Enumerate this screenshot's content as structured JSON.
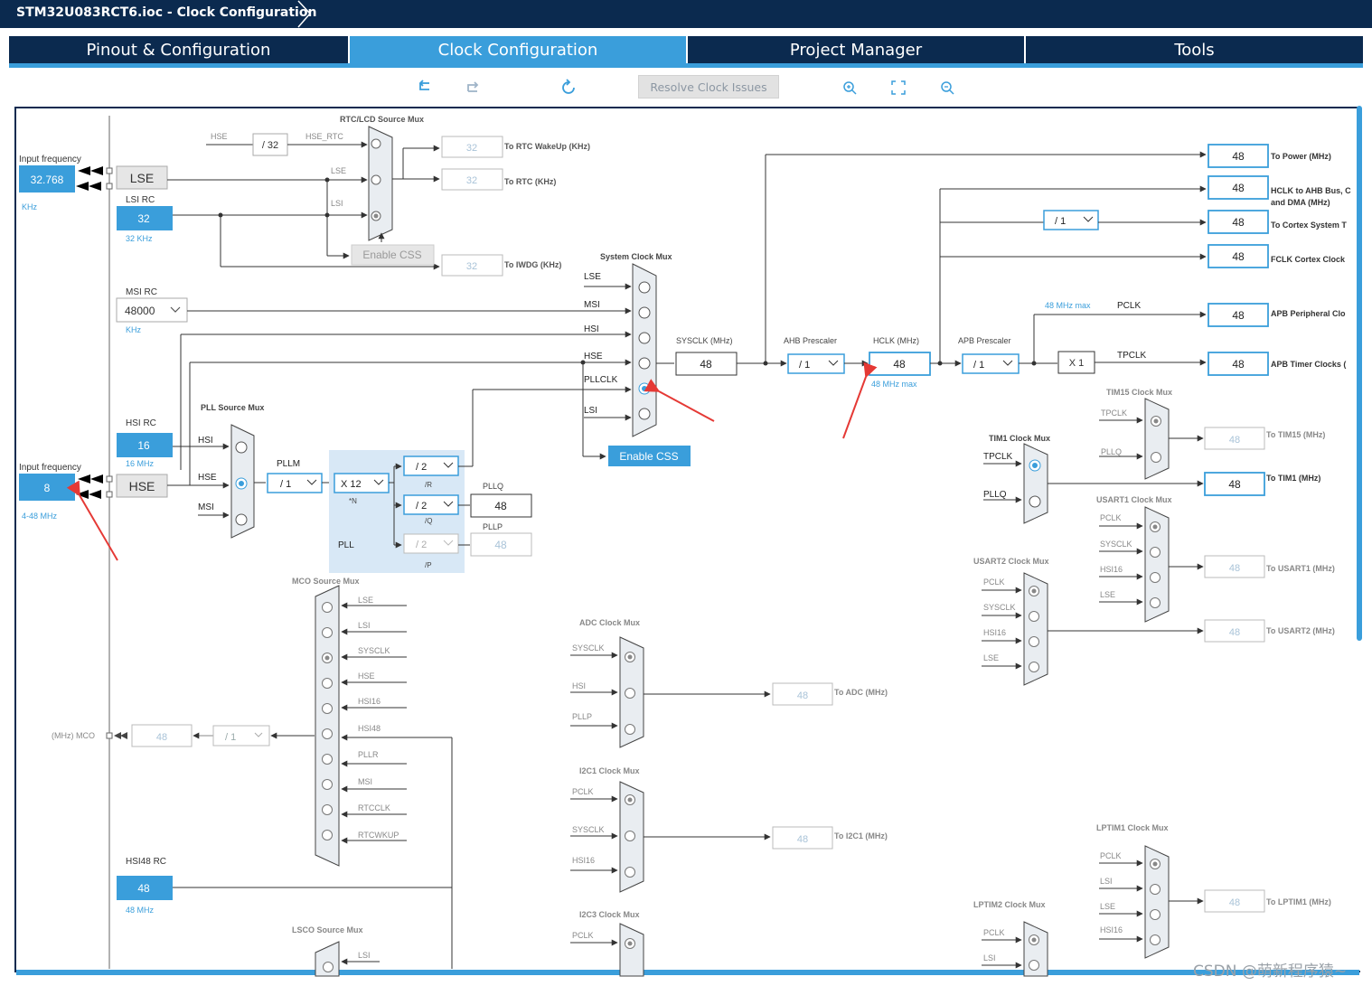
{
  "window": {
    "title": "STM32U083RCT6.ioc - Clock Configuration"
  },
  "tabs": [
    {
      "label": "Pinout & Configuration",
      "active": false
    },
    {
      "label": "Clock Configuration",
      "active": true
    },
    {
      "label": "Project Manager",
      "active": false
    },
    {
      "label": "Tools",
      "active": false
    }
  ],
  "toolbar": {
    "undo_icon": "undo-icon",
    "redo_icon": "redo-icon",
    "refresh_icon": "refresh-icon",
    "resolve_label": "Resolve Clock Issues",
    "zoom_in_icon": "zoom-in-icon",
    "fit_icon": "fit-icon",
    "zoom_out_icon": "zoom-out-icon"
  },
  "colors": {
    "navy": "#0b2a4f",
    "accent": "#3a9edb",
    "wire": "#333333",
    "muted": "#7d868f"
  },
  "left": {
    "input_freq_label": "Input frequency",
    "lse_input": "32.768",
    "lse_unit": "KHz",
    "lse_label": "LSE",
    "lsi_title": "LSI RC",
    "lsi_value": "32",
    "lsi_unit": "32 KHz",
    "msi_title": "MSI RC",
    "msi_value": "48000",
    "msi_unit": "KHz",
    "hsi_title": "HSI RC",
    "hsi_value": "16",
    "hsi_unit": "16 MHz",
    "hse_input_label": "Input frequency",
    "hse_input": "8",
    "hse_range": "4-48 MHz",
    "hse_label": "HSE",
    "hsi48_title": "HSI48 RC",
    "hsi48_value": "48",
    "hsi48_unit": "48 MHz",
    "mco_label": "(MHz) MCO",
    "mco_value": "48",
    "mco_div": "/ 1"
  },
  "rtc": {
    "title": "RTC/LCD Source Mux",
    "hse": "HSE",
    "div": "/ 32",
    "hse_rtc": "HSE_RTC",
    "lse": "LSE",
    "lsi": "LSI",
    "wakeup_value": "32",
    "wakeup_label": "To RTC WakeUp (KHz)",
    "rtc_value": "32",
    "rtc_label": "To RTC (KHz)",
    "enable_css": "Enable CSS",
    "iwdg_value": "32",
    "iwdg_label": "To IWDG (KHz)"
  },
  "sysmux": {
    "title": "System Clock Mux",
    "inputs": [
      "LSE",
      "MSI",
      "HSI",
      "HSE",
      "PLLCLK",
      "LSI"
    ],
    "enable_css": "Enable CSS",
    "sysclk_label": "SYSCLK (MHz)",
    "sysclk_value": "48"
  },
  "pll": {
    "src_title": "PLL Source Mux",
    "src_inputs": [
      "HSI",
      "HSE",
      "MSI"
    ],
    "pllm_label": "PLLM",
    "pllm_value": "/ 1",
    "n_value": "X 12",
    "n_label": "*N",
    "pll_label": "PLL",
    "r_value": "/ 2",
    "r_label": "/R",
    "q_value": "/ 2",
    "q_label": "/Q",
    "pllq_label": "PLLQ",
    "pllq_value": "48",
    "p_value": "/ 2",
    "p_label": "/P",
    "pllp_label": "PLLP",
    "pllp_value": "48"
  },
  "ahb": {
    "presc_label": "AHB Prescaler",
    "presc_value": "/ 1",
    "hclk_label": "HCLK (MHz)",
    "hclk_value": "48",
    "hclk_max": "48 MHz max",
    "apb_label": "APB Prescaler",
    "apb_value": "/ 1",
    "pclk_max": "48 MHz max",
    "pclk": "PCLK",
    "tpclk": "TPCLK",
    "x1": "X 1",
    "cortex_div": "/ 1"
  },
  "outputs": [
    {
      "value": "48",
      "label": "To Power (MHz)"
    },
    {
      "value": "48",
      "label": "HCLK to AHB Bus, C"
    },
    {
      "value": "48",
      "label": "To Cortex System T"
    },
    {
      "value": "48",
      "label": "FCLK Cortex Clock"
    },
    {
      "value": "48",
      "label": "APB Peripheral Clo"
    },
    {
      "value": "48",
      "label": "APB Timer Clocks ("
    }
  ],
  "outputs_extra": {
    "ahb_line2": "and DMA (MHz)"
  },
  "mco": {
    "title": "MCO Source Mux",
    "inputs": [
      "LSE",
      "LSI",
      "SYSCLK",
      "HSE",
      "HSI16",
      "HSI48",
      "PLLR",
      "MSI",
      "RTCCLK",
      "RTCWKUP"
    ]
  },
  "lsco": {
    "title": "LSCO Source Mux",
    "input": "LSI"
  },
  "adc": {
    "title": "ADC Clock Mux",
    "inputs": [
      "SYSCLK",
      "HSI",
      "PLLP"
    ],
    "value": "48",
    "label": "To ADC (MHz)"
  },
  "i2c1": {
    "title": "I2C1 Clock Mux",
    "inputs": [
      "PCLK",
      "SYSCLK",
      "HSI16"
    ],
    "value": "48",
    "label": "To I2C1 (MHz)"
  },
  "i2c3": {
    "title": "I2C3 Clock Mux",
    "inputs": [
      "PCLK"
    ]
  },
  "tim15": {
    "title": "TIM15 Clock Mux",
    "inputs": [
      "TPCLK",
      "PLLQ"
    ],
    "value": "48",
    "label": "To TIM15 (MHz)"
  },
  "tim1": {
    "title": "TIM1 Clock Mux",
    "inputs": [
      "TPCLK",
      "PLLQ"
    ],
    "value": "48",
    "label": "To TIM1 (MHz)"
  },
  "usart1": {
    "title": "USART1 Clock Mux",
    "inputs": [
      "PCLK",
      "SYSCLK",
      "HSI16",
      "LSE"
    ],
    "value": "48",
    "label": "To USART1 (MHz)"
  },
  "usart2": {
    "title": "USART2 Clock Mux",
    "inputs": [
      "PCLK",
      "SYSCLK",
      "HSI16",
      "LSE"
    ],
    "value": "48",
    "label": "To USART2 (MHz)"
  },
  "lptim1": {
    "title": "LPTIM1 Clock Mux",
    "inputs": [
      "PCLK",
      "LSI",
      "LSE",
      "HSI16"
    ],
    "value": "48",
    "label": "To LPTIM1 (MHz)"
  },
  "lptim2": {
    "title": "LPTIM2 Clock Mux",
    "inputs": [
      "PCLK",
      "LSI"
    ]
  },
  "watermark": "CSDN @萌新程序猿~"
}
